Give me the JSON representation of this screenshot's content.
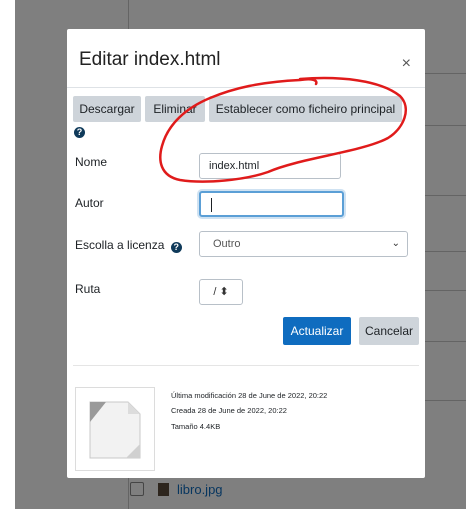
{
  "background": {
    "file_name": "libro.jpg"
  },
  "modal": {
    "title": "Editar index.html",
    "close_symbol": "×",
    "buttons": {
      "download": "Descargar",
      "delete": "Eliminar",
      "set_main": "Establecer como ficheiro principal"
    },
    "help_symbol": "?",
    "fields": {
      "name_label": "Nome",
      "name_value": "index.html",
      "author_label": "Autor",
      "author_value": "",
      "license_label": "Escolla a licenza",
      "license_value": "Outro",
      "path_label": "Ruta",
      "path_value": "/ ⬍"
    },
    "actions": {
      "update": "Actualizar",
      "cancel": "Cancelar"
    },
    "file_info": {
      "modified": "Última modificación  28 de June de 2022, 20:22",
      "created": "Creada  28 de June de 2022, 20:22",
      "size": "Tamaño  4.4KB"
    }
  },
  "colors": {
    "primary": "#0f6cbf",
    "annotation": "#e01b1b",
    "help_icon": "#0f3a5a"
  }
}
